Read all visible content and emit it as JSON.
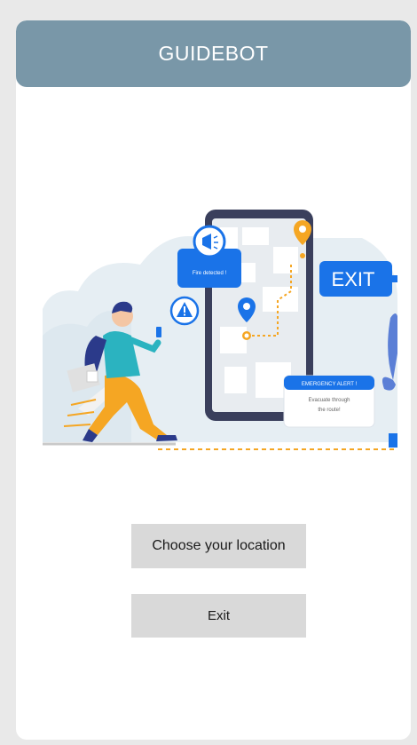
{
  "app": {
    "title": "GUIDEBOT"
  },
  "illustration": {
    "fire_bubble_text": "Fire detected !",
    "exit_sign_text": "EXIT",
    "alert_title": "EMERGENCY ALERT !",
    "alert_line1": "Evacuate through",
    "alert_line2": "the route!"
  },
  "actions": {
    "choose_location_label": "Choose your location",
    "exit_label": "Exit"
  },
  "colors": {
    "header": "#7997a8",
    "button": "#d9d9d9",
    "accent_blue": "#1a73e8",
    "accent_orange": "#f5a623"
  }
}
